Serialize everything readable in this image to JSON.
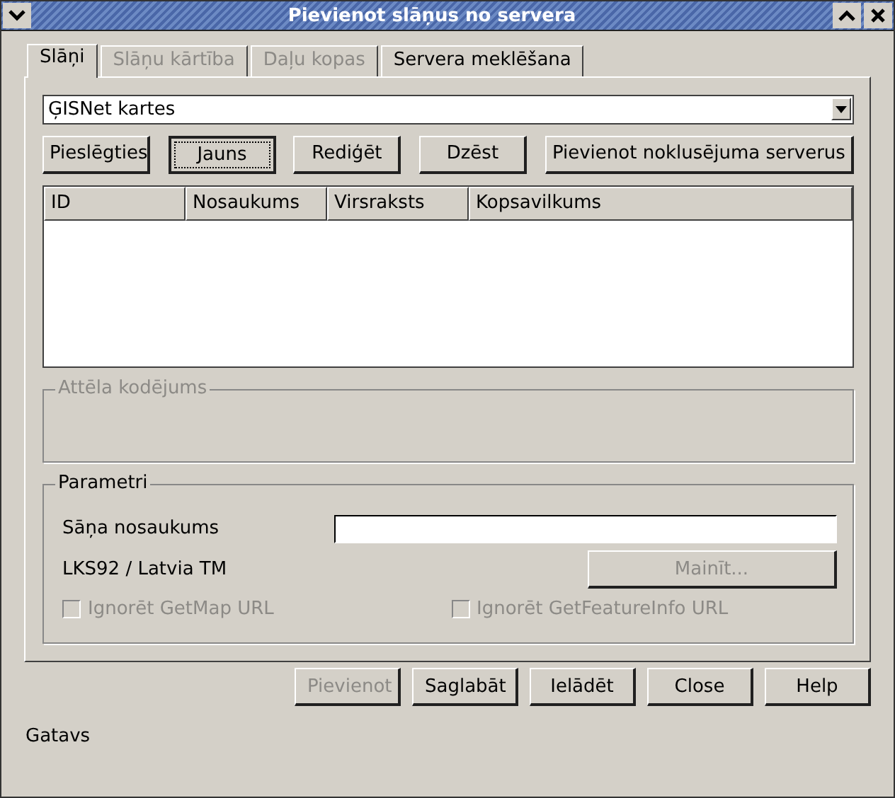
{
  "window": {
    "title": "Pievienot slāņus no servera"
  },
  "tabs": [
    {
      "label": "Slāņi",
      "selected": true,
      "disabled": false
    },
    {
      "label": "Slāņu kārtība",
      "selected": false,
      "disabled": true
    },
    {
      "label": "Daļu kopas",
      "selected": false,
      "disabled": true
    },
    {
      "label": "Servera meklēšana",
      "selected": false,
      "disabled": false
    }
  ],
  "server_combo": {
    "value": "ĢISNet kartes"
  },
  "server_buttons": [
    {
      "label": "Pieslēgties",
      "focused": false
    },
    {
      "label": "Jauns",
      "focused": true
    },
    {
      "label": "Rediģēt",
      "focused": false
    },
    {
      "label": "Dzēst",
      "focused": false
    },
    {
      "label": "Pievienot noklusējuma serverus",
      "focused": false
    }
  ],
  "table": {
    "columns": [
      "ID",
      "Nosaukums",
      "Virsraksts",
      "Kopsavilkums"
    ]
  },
  "image_encoding": {
    "title": "Attēla kodējums",
    "disabled": true
  },
  "parameters": {
    "title": "Parametri",
    "layer_name_label": "Sāņa nosaukums",
    "crs": "LKS92 / Latvia TM",
    "change_button": {
      "label": "Mainīt...",
      "disabled": true
    },
    "checkboxes": [
      {
        "label": "Ignorēt GetMap URL",
        "checked": false,
        "disabled": true
      },
      {
        "label": "Ignorēt GetFeatureInfo URL",
        "checked": false,
        "disabled": true
      }
    ]
  },
  "dialog_buttons": [
    {
      "label": "Pievienot",
      "disabled": true
    },
    {
      "label": "Saglabāt",
      "disabled": false
    },
    {
      "label": "Ielādēt",
      "disabled": false
    },
    {
      "label": "Close",
      "disabled": false
    },
    {
      "label": "Help",
      "disabled": false
    }
  ],
  "status_bar": "Gatavs"
}
